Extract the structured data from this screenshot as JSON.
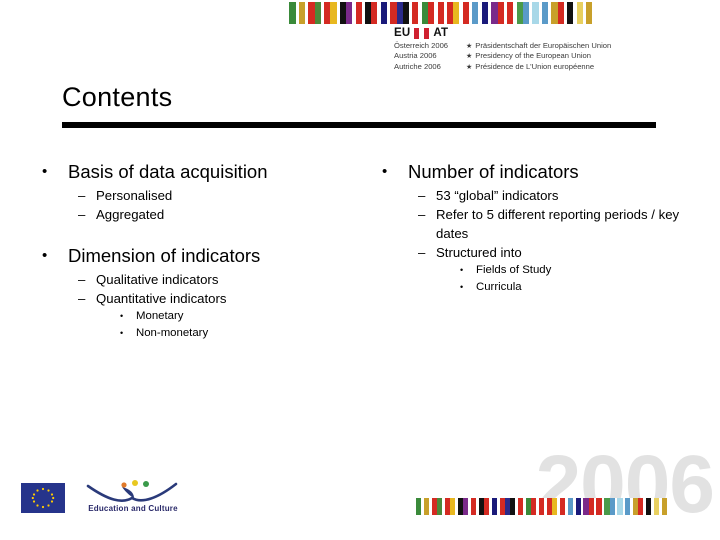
{
  "header": {
    "eu_label": "EU",
    "at_label": "AT",
    "at_flag_icon": "austria-flag-icon",
    "stripe_icon": "presidency-barcode-stripe",
    "years": [
      "Österreich 2006",
      "Austria 2006",
      "Autriche 2006"
    ],
    "titles": [
      "Präsidentschaft der Europäischen Union",
      "Presidency of the European Union",
      "Présidence de L'Union européenne"
    ],
    "star_glyph": "★"
  },
  "title": {
    "text": "Contents"
  },
  "columns": {
    "left": [
      {
        "level": 1,
        "mark": "•",
        "text": "Basis of data acquisition"
      },
      {
        "level": 2,
        "mark": "–",
        "text": "Personalised"
      },
      {
        "level": 2,
        "mark": "–",
        "text": "Aggregated"
      },
      {
        "level": 1,
        "mark": "•",
        "text": "Dimension of indicators"
      },
      {
        "level": 2,
        "mark": "–",
        "text": "Qualitative indicators"
      },
      {
        "level": 2,
        "mark": "–",
        "text": "Quantitative indicators"
      },
      {
        "level": 3,
        "mark": "•",
        "text": "Monetary"
      },
      {
        "level": 3,
        "mark": "•",
        "text": "Non-monetary"
      }
    ],
    "right": [
      {
        "level": 1,
        "mark": "•",
        "text": "Number of indicators"
      },
      {
        "level": 2,
        "mark": "–",
        "text": "53 “global” indicators"
      },
      {
        "level": 2,
        "mark": "–",
        "text": "Refer to 5 different reporting periods / key dates"
      },
      {
        "level": 2,
        "mark": "–",
        "text": "Structured into"
      },
      {
        "level": 3,
        "mark": "•",
        "text": "Fields of Study"
      },
      {
        "level": 3,
        "mark": "•",
        "text": "Curricula"
      }
    ]
  },
  "footer": {
    "eu_flag_icon": "european-union-flag-icon",
    "edu_logo_icon": "education-and-culture-swoosh-icon",
    "edu_logo_text": "Education and Culture",
    "watermark": "2006",
    "stripe_icon": "presidency-barcode-stripe"
  },
  "colors": {
    "eu_blue": "#26348b",
    "star_yellow": "#ffcc00",
    "austria_red": "#d02030",
    "watermark_gray": "#e2e2e2",
    "rule_black": "#000000",
    "edu_navy": "#2a2a6a"
  },
  "stripe_colors": [
    "#ffffff",
    "#3a8a3a",
    "#ffffff",
    "#c8a02a",
    "#ffffff",
    "#d42a22",
    "#4a8a3a",
    "#ffffff",
    "#d42a22",
    "#e8b820",
    "#ffffff",
    "#111111",
    "#7a2a8a",
    "#ffffff",
    "#d42a22",
    "#ffffff",
    "#111111",
    "#d42a22",
    "#ffffff",
    "#1a1a7a",
    "#ffffff",
    "#d42a22",
    "#2a2a8a",
    "#111111",
    "#ffffff",
    "#d42a22",
    "#ffffff",
    "#3a8a3a",
    "#d42a22",
    "#ffffff",
    "#d42a22",
    "#ffffff",
    "#d42a22",
    "#e8b820",
    "#ffffff",
    "#d42a22",
    "#ffffff",
    "#5a9ac8",
    "#ffffff",
    "#1a1a7a",
    "#ffffff",
    "#7a2a8a",
    "#d42a22",
    "#ffffff",
    "#d42a22",
    "#ffffff",
    "#4a9a4a",
    "#5a9ac8",
    "#ffffff",
    "#a8d8e8",
    "#ffffff",
    "#5a9ac8",
    "#ffffff",
    "#c8a02a",
    "#d42a22",
    "#ffffff",
    "#111111",
    "#ffffff",
    "#e8d060",
    "#ffffff",
    "#c8a02a",
    "#ffffff"
  ]
}
